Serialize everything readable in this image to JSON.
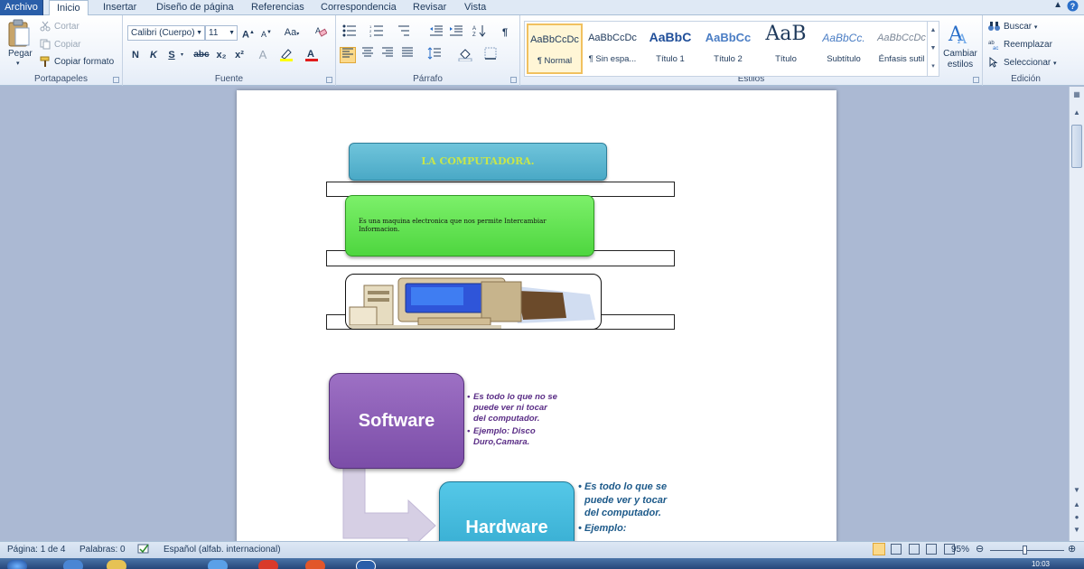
{
  "tabs": {
    "file": "Archivo",
    "items": [
      "Inicio",
      "Insertar",
      "Diseño de página",
      "Referencias",
      "Correspondencia",
      "Revisar",
      "Vista"
    ]
  },
  "clipboard": {
    "paste": "Pegar",
    "cut": "Cortar",
    "copy": "Copiar",
    "format_painter": "Copiar formato",
    "label": "Portapapeles"
  },
  "font": {
    "family": "Calibri (Cuerpo)",
    "size": "11",
    "case_btn": "Aa",
    "bold": "N",
    "italic": "K",
    "underline": "S",
    "strike": "abc",
    "subscript": "x₂",
    "superscript": "x²",
    "label": "Fuente"
  },
  "paragraph": {
    "pilcrow": "¶",
    "label": "Párrafo"
  },
  "styles": {
    "items": [
      {
        "preview": "AaBbCcDc",
        "name": "¶ Normal"
      },
      {
        "preview": "AaBbCcDc",
        "name": "¶ Sin espa..."
      },
      {
        "preview": "AaBbC",
        "name": "Título 1"
      },
      {
        "preview": "AaBbCc",
        "name": "Título 2"
      },
      {
        "preview": "AaB",
        "name": "Título"
      },
      {
        "preview": "AaBbCc.",
        "name": "Subtítulo"
      },
      {
        "preview": "AaBbCcDc",
        "name": "Énfasis sutil"
      }
    ],
    "change_styles": "Cambiar estilos",
    "label": "Estilos"
  },
  "editing": {
    "find": "Buscar",
    "replace": "Reemplazar",
    "select": "Seleccionar",
    "label": "Edición"
  },
  "document": {
    "title": "LA COMPUTADORA.",
    "definition": "Es una maquina electronica que nos permite Intercambiar Informacion.",
    "software": {
      "label": "Software",
      "bullets": [
        "Es todo lo que no se puede ver ni tocar del computador.",
        "Ejemplo: Disco Duro,Camara."
      ]
    },
    "hardware": {
      "label": "Hardware",
      "bullets": [
        "Es todo lo que se puede ver y tocar del computador.",
        "Ejemplo:"
      ]
    }
  },
  "status": {
    "page": "Página: 1 de 4",
    "words": "Palabras: 0",
    "language": "Español (alfab. internacional)",
    "zoom": "95%",
    "zoom_level": 0.95
  },
  "taskbar": {
    "clock": "10:03"
  },
  "colors": {
    "accent": "#2a5ea9",
    "title_fill": "#4aa9c6",
    "definition_fill": "#4ed63f",
    "software_fill": "#7b4da8",
    "hardware_fill": "#2fa6cc"
  }
}
